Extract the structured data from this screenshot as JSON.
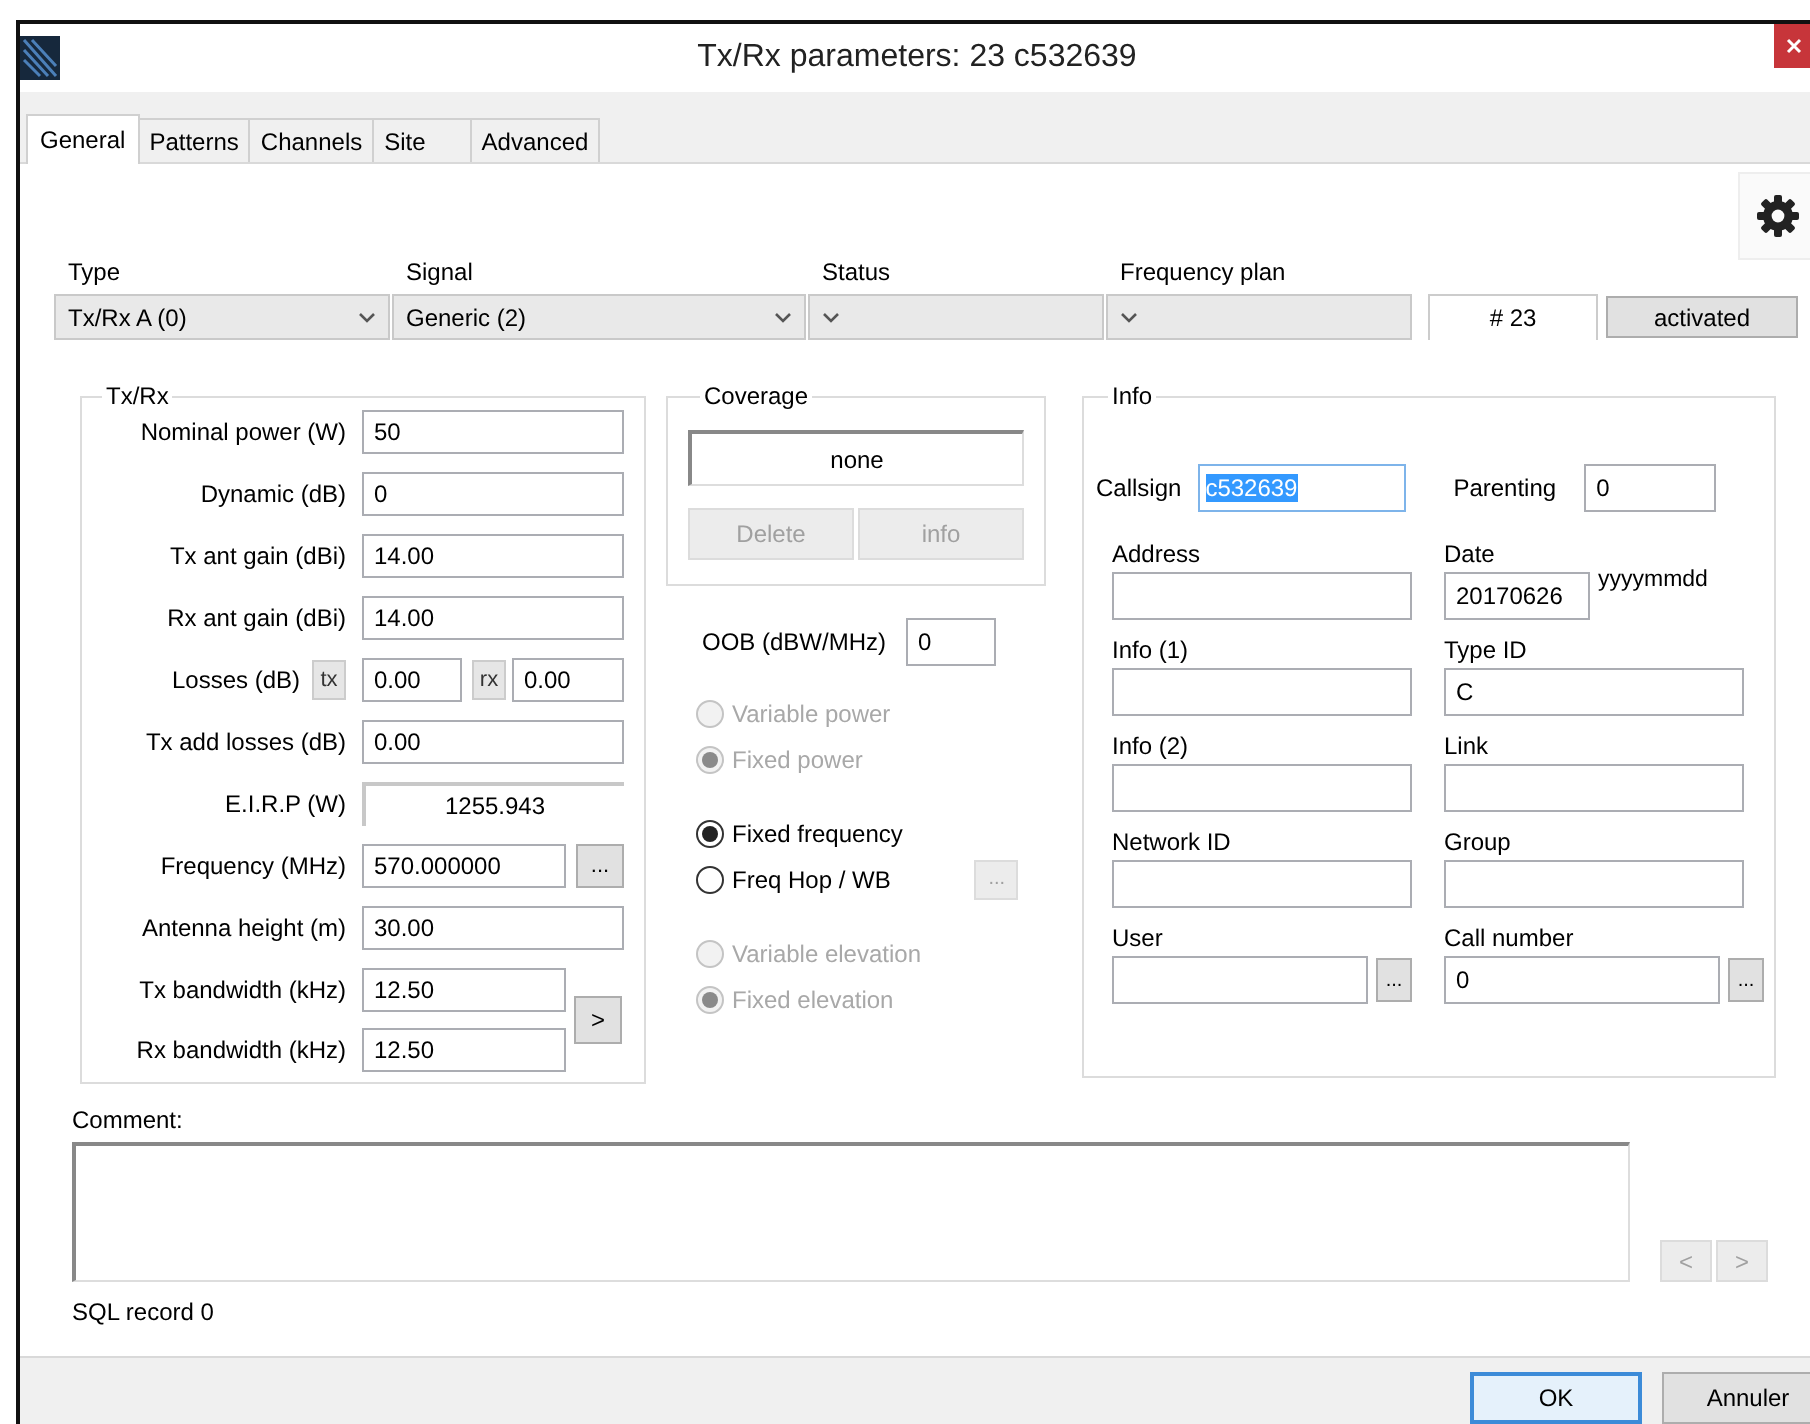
{
  "window": {
    "title": "Tx/Rx parameters: 23 c532639"
  },
  "tabs": [
    {
      "label": "General",
      "selected": true
    },
    {
      "label": "Patterns",
      "selected": false
    },
    {
      "label": "Channels",
      "selected": false
    },
    {
      "label": "Site",
      "selected": false
    },
    {
      "label": "Advanced",
      "selected": false
    }
  ],
  "header": {
    "combos": [
      {
        "label": "Type",
        "value": "Tx/Rx A (0)"
      },
      {
        "label": "Signal",
        "value": "Generic (2)"
      },
      {
        "label": "Status"
      },
      {
        "label": "Frequency plan"
      }
    ],
    "number": "# 23",
    "state_button": "activated"
  },
  "txrx": {
    "title": "Tx/Rx",
    "rows": [
      {
        "kind": "field",
        "label": "Nominal power (W)",
        "value": "50"
      },
      {
        "kind": "field",
        "label": "Dynamic (dB)",
        "value": "0"
      },
      {
        "kind": "field",
        "label": "Tx ant gain (dBi)",
        "value": "14.00"
      },
      {
        "kind": "field",
        "label": "Rx ant gain (dBi)",
        "value": "14.00"
      },
      {
        "kind": "losses",
        "label": "Losses (dB)",
        "tx_label": "tx",
        "tx_value": "0.00",
        "rx_label": "rx",
        "rx_value": "0.00"
      },
      {
        "kind": "field",
        "label": "Tx add losses (dB)",
        "value": "0.00"
      },
      {
        "kind": "readout",
        "label": "E.I.R.P (W)",
        "value": "1255.943"
      },
      {
        "kind": "more",
        "label": "Frequency (MHz)",
        "value": "570.000000",
        "button": "..."
      },
      {
        "kind": "field",
        "label": "Antenna height (m)",
        "value": "30.00"
      }
    ],
    "bandwidths": [
      {
        "label": "Tx bandwidth (kHz)",
        "value": "12.50"
      },
      {
        "label": "Rx bandwidth (kHz)",
        "value": "12.50"
      }
    ],
    "bandwidth_button": ">"
  },
  "coverage": {
    "title": "Coverage",
    "value": "none",
    "buttons": [
      {
        "label": "Delete",
        "disabled": true
      },
      {
        "label": "info",
        "disabled": true
      }
    ]
  },
  "oob": {
    "label": "OOB (dBW/MHz)",
    "value": "0"
  },
  "radio_groups": [
    [
      {
        "label": "Variable power",
        "selected": false,
        "disabled": true
      },
      {
        "label": "Fixed power",
        "selected": true,
        "disabled": true
      }
    ],
    [
      {
        "label": "Fixed frequency",
        "selected": true,
        "disabled": false
      },
      {
        "label": "Freq Hop / WB",
        "selected": false,
        "disabled": false,
        "button": "..."
      }
    ],
    [
      {
        "label": "Variable elevation",
        "selected": false,
        "disabled": true
      },
      {
        "label": "Fixed elevation",
        "selected": true,
        "disabled": true
      }
    ]
  ],
  "info": {
    "title": "Info",
    "callsign": {
      "label": "Callsign",
      "value": "c532639",
      "text_selected": true
    },
    "parenting": {
      "label": "Parenting",
      "value": "0"
    },
    "fields": [
      {
        "label": "Address"
      },
      {
        "label": "Date",
        "value": "20170626",
        "hint": "yyyymmdd"
      },
      {
        "label": "Info (1)"
      },
      {
        "label": "Type ID",
        "value": "C"
      },
      {
        "label": "Info (2)"
      },
      {
        "label": "Link"
      },
      {
        "label": "Network ID"
      },
      {
        "label": "Group"
      },
      {
        "label": "User",
        "button": "..."
      },
      {
        "label": "Call number",
        "value": "0",
        "button": "..."
      }
    ]
  },
  "comment": {
    "label": "Comment:"
  },
  "nav_buttons": [
    {
      "label": "<",
      "disabled": true
    },
    {
      "label": ">",
      "disabled": true
    }
  ],
  "sql_record": "SQL record 0",
  "buttons": [
    {
      "label": "OK",
      "default": true
    },
    {
      "label": "Annuler",
      "default": false
    }
  ]
}
